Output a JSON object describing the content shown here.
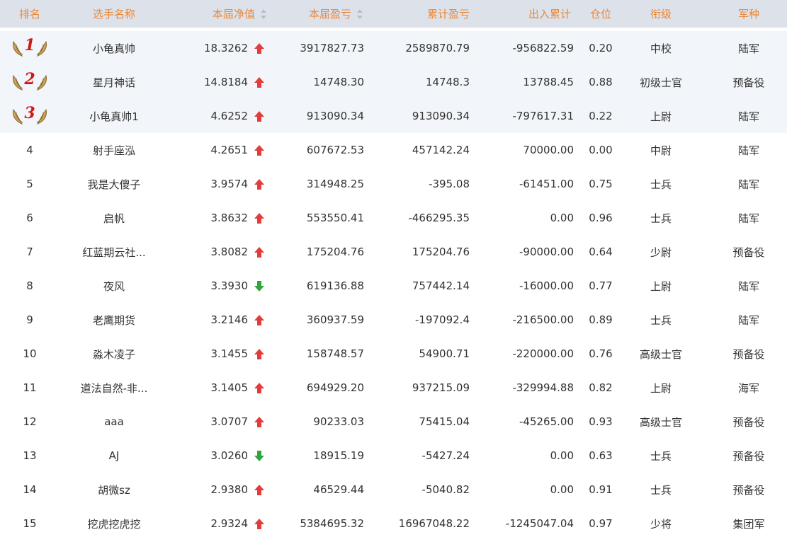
{
  "headers": {
    "rank": "排名",
    "name": "选手名称",
    "nav": "本届净值",
    "profit": "本届盈亏",
    "cum": "累计盈亏",
    "flow": "出入累计",
    "pos": "仓位",
    "grade": "衔级",
    "branch": "军种"
  },
  "colors": {
    "header_text": "#e8883a",
    "header_bg": "#dde2ea",
    "up": "#e23c3c",
    "down": "#2fa53a"
  },
  "rows": [
    {
      "rank": "1",
      "medal": true,
      "name": "小龟真帅",
      "nav": "18.3262",
      "trend": "up",
      "profit": "3917827.73",
      "cum": "2589870.79",
      "flow": "-956822.59",
      "pos": "0.20",
      "grade": "中校",
      "branch": "陆军"
    },
    {
      "rank": "2",
      "medal": true,
      "name": "星月神话",
      "nav": "14.8184",
      "trend": "up",
      "profit": "14748.30",
      "cum": "14748.3",
      "flow": "13788.45",
      "pos": "0.88",
      "grade": "初级士官",
      "branch": "预备役"
    },
    {
      "rank": "3",
      "medal": true,
      "name": "小龟真帅1",
      "nav": "4.6252",
      "trend": "up",
      "profit": "913090.34",
      "cum": "913090.34",
      "flow": "-797617.31",
      "pos": "0.22",
      "grade": "上尉",
      "branch": "陆军"
    },
    {
      "rank": "4",
      "medal": false,
      "name": "射手座泓",
      "nav": "4.2651",
      "trend": "up",
      "profit": "607672.53",
      "cum": "457142.24",
      "flow": "70000.00",
      "pos": "0.00",
      "grade": "中尉",
      "branch": "陆军"
    },
    {
      "rank": "5",
      "medal": false,
      "name": "我是大傻子",
      "nav": "3.9574",
      "trend": "up",
      "profit": "314948.25",
      "cum": "-395.08",
      "flow": "-61451.00",
      "pos": "0.75",
      "grade": "士兵",
      "branch": "陆军"
    },
    {
      "rank": "6",
      "medal": false,
      "name": "启帆",
      "nav": "3.8632",
      "trend": "up",
      "profit": "553550.41",
      "cum": "-466295.35",
      "flow": "0.00",
      "pos": "0.96",
      "grade": "士兵",
      "branch": "陆军"
    },
    {
      "rank": "7",
      "medal": false,
      "name": "红蓝期云社...",
      "nav": "3.8082",
      "trend": "up",
      "profit": "175204.76",
      "cum": "175204.76",
      "flow": "-90000.00",
      "pos": "0.64",
      "grade": "少尉",
      "branch": "预备役"
    },
    {
      "rank": "8",
      "medal": false,
      "name": "夜风",
      "nav": "3.3930",
      "trend": "down",
      "profit": "619136.88",
      "cum": "757442.14",
      "flow": "-16000.00",
      "pos": "0.77",
      "grade": "上尉",
      "branch": "陆军"
    },
    {
      "rank": "9",
      "medal": false,
      "name": "老鹰期货",
      "nav": "3.2146",
      "trend": "up",
      "profit": "360937.59",
      "cum": "-197092.4",
      "flow": "-216500.00",
      "pos": "0.89",
      "grade": "士兵",
      "branch": "陆军"
    },
    {
      "rank": "10",
      "medal": false,
      "name": "淼木凌子",
      "nav": "3.1455",
      "trend": "up",
      "profit": "158748.57",
      "cum": "54900.71",
      "flow": "-220000.00",
      "pos": "0.76",
      "grade": "高级士官",
      "branch": "预备役"
    },
    {
      "rank": "11",
      "medal": false,
      "name": "道法自然-非...",
      "nav": "3.1405",
      "trend": "up",
      "profit": "694929.20",
      "cum": "937215.09",
      "flow": "-329994.88",
      "pos": "0.82",
      "grade": "上尉",
      "branch": "海军"
    },
    {
      "rank": "12",
      "medal": false,
      "name": "aaa",
      "nav": "3.0707",
      "trend": "up",
      "profit": "90233.03",
      "cum": "75415.04",
      "flow": "-45265.00",
      "pos": "0.93",
      "grade": "高级士官",
      "branch": "预备役"
    },
    {
      "rank": "13",
      "medal": false,
      "name": "AJ",
      "nav": "3.0260",
      "trend": "down",
      "profit": "18915.19",
      "cum": "-5427.24",
      "flow": "0.00",
      "pos": "0.63",
      "grade": "士兵",
      "branch": "预备役"
    },
    {
      "rank": "14",
      "medal": false,
      "name": "胡微sz",
      "nav": "2.9380",
      "trend": "up",
      "profit": "46529.44",
      "cum": "-5040.82",
      "flow": "0.00",
      "pos": "0.91",
      "grade": "士兵",
      "branch": "预备役"
    },
    {
      "rank": "15",
      "medal": false,
      "name": "挖虎挖虎挖",
      "nav": "2.9324",
      "trend": "up",
      "profit": "5384695.32",
      "cum": "16967048.22",
      "flow": "-1245047.04",
      "pos": "0.97",
      "grade": "少将",
      "branch": "集团军"
    }
  ]
}
